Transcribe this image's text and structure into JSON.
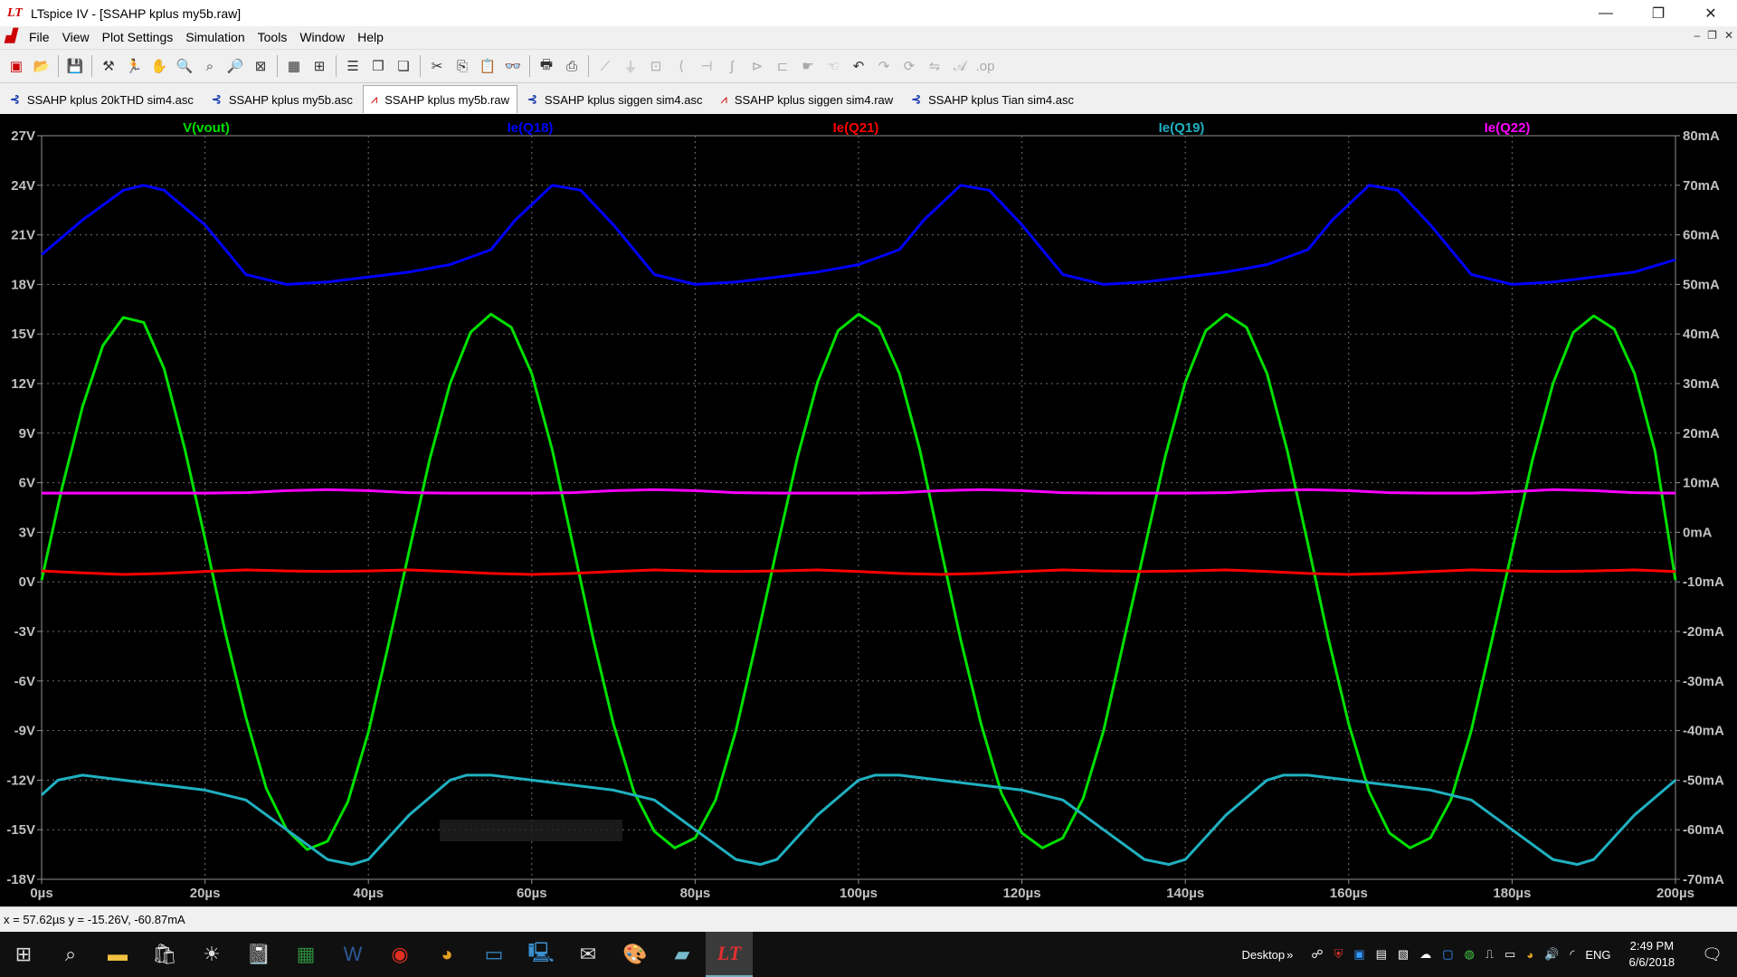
{
  "window": {
    "title": "LTspice IV - [SSAHP kplus my5b.raw]",
    "controls": {
      "minimize": "—",
      "restore": "❐",
      "close": "✕"
    }
  },
  "menu": {
    "items": [
      "File",
      "View",
      "Plot Settings",
      "Simulation",
      "Tools",
      "Window",
      "Help"
    ],
    "mdi_controls": [
      "–",
      "❐",
      "✕"
    ]
  },
  "tabs": [
    {
      "label": "SSAHP kplus 20kTHD sim4.asc",
      "icon": "schematic-icon",
      "active": false
    },
    {
      "label": "SSAHP kplus my5b.asc",
      "icon": "schematic-icon",
      "active": false
    },
    {
      "label": "SSAHP kplus my5b.raw",
      "icon": "waveform-icon",
      "active": true
    },
    {
      "label": "SSAHP kplus siggen sim4.asc",
      "icon": "schematic-icon",
      "active": false
    },
    {
      "label": "SSAHP kplus siggen sim4.raw",
      "icon": "waveform-icon",
      "active": false
    },
    {
      "label": "SSAHP kplus Tian sim4.asc",
      "icon": "schematic-icon",
      "active": false
    }
  ],
  "chart_data": {
    "type": "line",
    "x_ticks": [
      "0µs",
      "20µs",
      "40µs",
      "60µs",
      "80µs",
      "100µs",
      "120µs",
      "140µs",
      "160µs",
      "180µs",
      "200µs"
    ],
    "xlim": [
      0,
      200
    ],
    "left_axis": {
      "ticks": [
        "27V",
        "24V",
        "21V",
        "18V",
        "15V",
        "12V",
        "9V",
        "6V",
        "3V",
        "0V",
        "-3V",
        "-6V",
        "-9V",
        "-12V",
        "-15V",
        "-18V"
      ],
      "ylim": [
        -18,
        27
      ]
    },
    "right_axis": {
      "ticks": [
        "80mA",
        "70mA",
        "60mA",
        "50mA",
        "40mA",
        "30mA",
        "20mA",
        "10mA",
        "0mA",
        "-10mA",
        "-20mA",
        "-30mA",
        "-40mA",
        "-50mA",
        "-60mA",
        "-70mA"
      ],
      "ylim": [
        -70,
        80
      ]
    },
    "grid": true,
    "series": [
      {
        "name": "V(vout)",
        "color": "#00e000",
        "axis": "left",
        "x": [
          0,
          2.5,
          5,
          7.5,
          10,
          12.5,
          15,
          17.5,
          20,
          22.5,
          25,
          27.5,
          30,
          32.5,
          35,
          37.5,
          40,
          42.5,
          45,
          47.5,
          50,
          52.5,
          55,
          57.5,
          60,
          62.5,
          65,
          67.5,
          70,
          72.5,
          75,
          77.5,
          80,
          82.5,
          85,
          87.5,
          90,
          92.5,
          95,
          97.5,
          100,
          102.5,
          105,
          107.5,
          110,
          112.5,
          115,
          117.5,
          120,
          122.5,
          125,
          127.5,
          130,
          132.5,
          135,
          137.5,
          140,
          142.5,
          145,
          147.5,
          150,
          152.5,
          155,
          157.5,
          160,
          162.5,
          165,
          167.5,
          170,
          172.5,
          175,
          177.5,
          180,
          182.5,
          185,
          187.5,
          190,
          192.5,
          195,
          197.5,
          200
        ],
        "y": [
          0.1,
          5.7,
          10.6,
          14.3,
          16.0,
          15.7,
          12.9,
          8.1,
          2.6,
          -3.1,
          -8.2,
          -12.5,
          -15.0,
          -16.2,
          -15.7,
          -13.3,
          -9.1,
          -3.7,
          1.9,
          7.4,
          12.0,
          15.1,
          16.2,
          15.4,
          12.6,
          8.0,
          2.3,
          -3.4,
          -8.6,
          -12.7,
          -15.1,
          -16.1,
          -15.5,
          -13.2,
          -9.0,
          -3.6,
          2.0,
          7.5,
          12.1,
          15.2,
          16.2,
          15.4,
          12.6,
          8.0,
          2.2,
          -3.5,
          -8.6,
          -12.8,
          -15.2,
          -16.1,
          -15.5,
          -13.1,
          -9.0,
          -3.5,
          2.0,
          7.5,
          12.1,
          15.2,
          16.2,
          15.4,
          12.6,
          7.9,
          2.3,
          -3.4,
          -8.6,
          -12.7,
          -15.2,
          -16.1,
          -15.5,
          -13.2,
          -9.0,
          -3.6,
          1.9,
          7.4,
          12.0,
          15.1,
          16.1,
          15.3,
          12.6,
          7.9,
          0.1
        ]
      },
      {
        "name": "Ie(Q18)",
        "color": "#0000ff",
        "axis": "right",
        "x": [
          0,
          5,
          10,
          12.5,
          15,
          20,
          25,
          30,
          35,
          40,
          45,
          50,
          55,
          58,
          62.5,
          66,
          70,
          75,
          80,
          85,
          90,
          95,
          100,
          105,
          108,
          112.5,
          116,
          120,
          125,
          130,
          135,
          140,
          145,
          150,
          155,
          158,
          162.5,
          166,
          170,
          175,
          180,
          185,
          190,
          195,
          200
        ],
        "y": [
          56,
          63,
          69,
          70,
          69,
          62,
          52,
          50,
          50.5,
          51.5,
          52.5,
          54,
          57,
          63,
          70,
          69,
          62,
          52,
          50,
          50.5,
          51.5,
          52.5,
          54,
          57,
          63,
          70,
          69,
          62,
          52,
          50,
          50.5,
          51.5,
          52.5,
          54,
          57,
          63,
          70,
          69,
          62,
          52,
          50,
          50.5,
          51.5,
          52.5,
          55
        ]
      },
      {
        "name": "Ie(Q21)",
        "color": "#ff0000",
        "axis": "right",
        "x": [
          0,
          5,
          10,
          15,
          20,
          25,
          30,
          35,
          40,
          45,
          50,
          55,
          60,
          65,
          70,
          75,
          80,
          85,
          90,
          95,
          100,
          105,
          110,
          115,
          120,
          125,
          130,
          135,
          140,
          145,
          150,
          155,
          160,
          165,
          170,
          175,
          180,
          185,
          190,
          195,
          200
        ],
        "y": [
          -7.8,
          -8.2,
          -8.5,
          -8.3,
          -7.9,
          -7.6,
          -7.8,
          -7.9,
          -7.8,
          -7.6,
          -7.9,
          -8.3,
          -8.5,
          -8.3,
          -7.9,
          -7.6,
          -7.8,
          -7.9,
          -7.8,
          -7.6,
          -7.9,
          -8.3,
          -8.5,
          -8.3,
          -7.9,
          -7.6,
          -7.8,
          -7.9,
          -7.8,
          -7.6,
          -7.9,
          -8.3,
          -8.5,
          -8.3,
          -7.9,
          -7.6,
          -7.8,
          -7.9,
          -7.8,
          -7.6,
          -7.9
        ]
      },
      {
        "name": "Ie(Q19)",
        "color": "#20b0c0",
        "axis": "right",
        "x": [
          0,
          2,
          5,
          10,
          15,
          20,
          25,
          30,
          35,
          38,
          40,
          45,
          50,
          52,
          55,
          60,
          65,
          70,
          75,
          80,
          85,
          88,
          90,
          95,
          100,
          102,
          105,
          110,
          115,
          120,
          125,
          130,
          135,
          138,
          140,
          145,
          150,
          152,
          155,
          160,
          165,
          170,
          175,
          180,
          185,
          188,
          190,
          195,
          200
        ],
        "y": [
          -53,
          -50,
          -49,
          -50,
          -51,
          -52,
          -54,
          -60,
          -66,
          -67,
          -66,
          -57,
          -50,
          -49,
          -49,
          -50,
          -51,
          -52,
          -54,
          -60,
          -66,
          -67,
          -66,
          -57,
          -50,
          -49,
          -49,
          -50,
          -51,
          -52,
          -54,
          -60,
          -66,
          -67,
          -66,
          -57,
          -50,
          -49,
          -49,
          -50,
          -51,
          -52,
          -54,
          -60,
          -66,
          -67,
          -66,
          -57,
          -50
        ]
      },
      {
        "name": "Ie(Q22)",
        "color": "#ff00ff",
        "axis": "right",
        "x": [
          0,
          10,
          20,
          25,
          30,
          35,
          40,
          45,
          50,
          55,
          60,
          65,
          70,
          75,
          80,
          85,
          90,
          95,
          100,
          105,
          110,
          115,
          120,
          125,
          130,
          135,
          140,
          145,
          150,
          155,
          160,
          165,
          170,
          175,
          180,
          185,
          190,
          195,
          200
        ],
        "y": [
          7.9,
          7.9,
          7.9,
          8.0,
          8.4,
          8.6,
          8.4,
          8.0,
          7.9,
          7.9,
          7.9,
          8.0,
          8.4,
          8.6,
          8.4,
          8.0,
          7.9,
          7.9,
          7.9,
          8.0,
          8.4,
          8.6,
          8.4,
          8.0,
          7.9,
          7.9,
          7.9,
          8.0,
          8.4,
          8.6,
          8.4,
          8.0,
          7.9,
          7.9,
          8.2,
          8.6,
          8.4,
          8.0,
          7.9
        ]
      }
    ]
  },
  "status": {
    "readout": "x = 57.62µs   y = -15.26V, -60.87mA"
  },
  "taskbar": {
    "desktop_label": "Desktop",
    "language": "ENG",
    "time": "2:49 PM",
    "date": "6/6/2018"
  }
}
